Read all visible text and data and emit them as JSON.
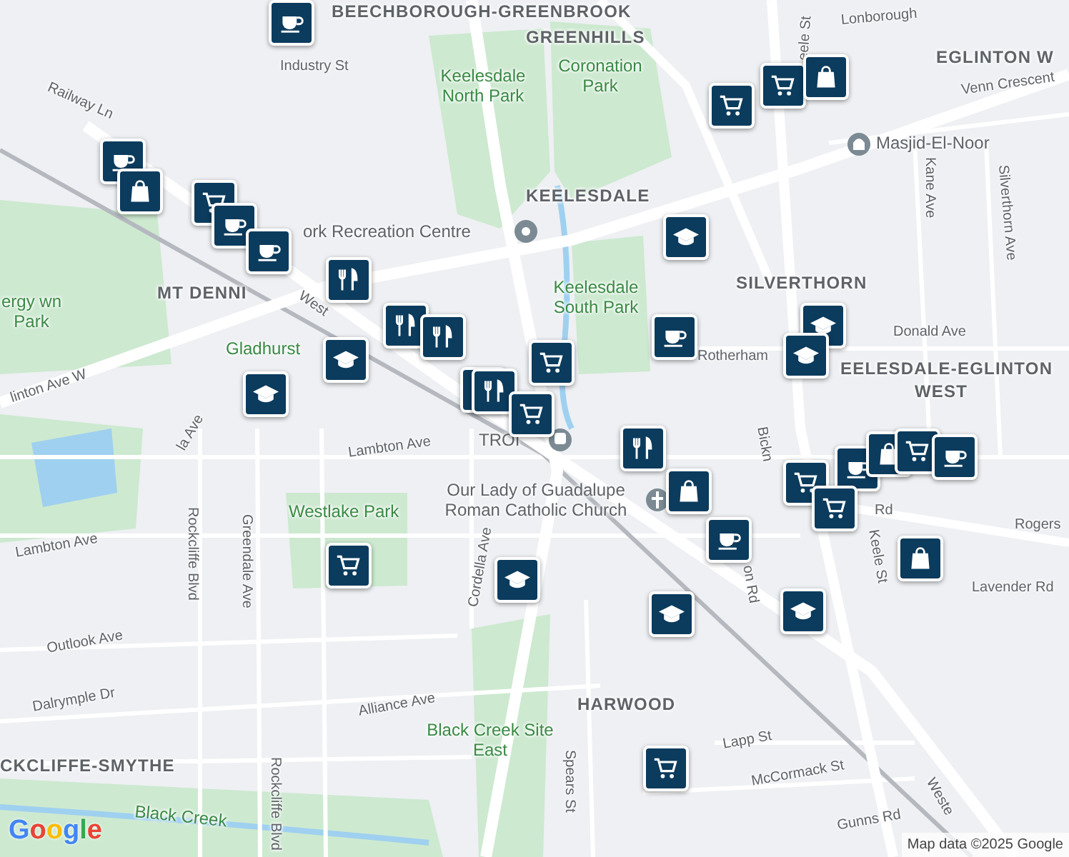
{
  "map": {
    "labels": [
      {
        "text": "BEECHBOROUGH-GREENBROOK",
        "kind": "district"
      },
      {
        "text": "GREENHILLS",
        "kind": "district"
      },
      {
        "text": "EGLINTON W",
        "kind": "district"
      },
      {
        "text": "KEELESDALE",
        "kind": "district"
      },
      {
        "text": "SILVERTHORN",
        "kind": "district"
      },
      {
        "text": "MT DENNI",
        "kind": "district"
      },
      {
        "text": "EELESDALE-EGLINTON",
        "kind": "district"
      },
      {
        "text": "WEST",
        "kind": "district"
      },
      {
        "text": "HARWOOD",
        "kind": "district"
      },
      {
        "text": "CKCLIFFE-SMYTHE",
        "kind": "district"
      },
      {
        "text": "Keelesdale North Park",
        "kind": "park"
      },
      {
        "text": "Coronation Park",
        "kind": "park"
      },
      {
        "text": "Keelesdale South Park",
        "kind": "park"
      },
      {
        "text": "Westlake Park",
        "kind": "park"
      },
      {
        "text": "Black Creek Site East",
        "kind": "park"
      },
      {
        "text": "ergy wn Park",
        "kind": "park"
      },
      {
        "text": "Gladhurst",
        "kind": "park"
      },
      {
        "text": "Black Creek",
        "kind": "park"
      },
      {
        "text": "ork Recreation Centre",
        "kind": "place"
      },
      {
        "text": "Masjid-El-Noor",
        "kind": "place"
      },
      {
        "text": "Our Lady of Guadalupe Roman Catholic Church",
        "kind": "place"
      },
      {
        "text": "TROI",
        "kind": "place"
      },
      {
        "text": "Industry St",
        "kind": "street"
      },
      {
        "text": "Railway Ln",
        "kind": "street"
      },
      {
        "text": "Venn Crescent",
        "kind": "street"
      },
      {
        "text": "Kane Ave",
        "kind": "street"
      },
      {
        "text": "Silverthorn Ave",
        "kind": "street"
      },
      {
        "text": "eele St",
        "kind": "street"
      },
      {
        "text": "Lonborough",
        "kind": "street"
      },
      {
        "text": "Rotherham",
        "kind": "street"
      },
      {
        "text": "Donald Ave",
        "kind": "street"
      },
      {
        "text": "Lambton Ave",
        "kind": "street"
      },
      {
        "text": "Lambton Ave",
        "kind": "street"
      },
      {
        "text": "la Ave",
        "kind": "street"
      },
      {
        "text": "Rockcliffe Blvd",
        "kind": "street"
      },
      {
        "text": "Greendale Ave",
        "kind": "street"
      },
      {
        "text": "Cordella Ave",
        "kind": "street"
      },
      {
        "text": "Outlook Ave",
        "kind": "street"
      },
      {
        "text": "Dalrymple Dr",
        "kind": "street"
      },
      {
        "text": "Alliance Ave",
        "kind": "street"
      },
      {
        "text": "Rockcliffe Blvd",
        "kind": "street"
      },
      {
        "text": "Spears St",
        "kind": "street"
      },
      {
        "text": "Lapp St",
        "kind": "street"
      },
      {
        "text": "McCormack St",
        "kind": "street"
      },
      {
        "text": "Gunns Rd",
        "kind": "street"
      },
      {
        "text": "Rogers",
        "kind": "street"
      },
      {
        "text": "Lavender Rd",
        "kind": "street"
      },
      {
        "text": "Keele St",
        "kind": "street"
      },
      {
        "text": "on Rd",
        "kind": "street"
      },
      {
        "text": "linton Ave W",
        "kind": "street"
      },
      {
        "text": "West",
        "kind": "street"
      },
      {
        "text": "Bickn",
        "kind": "street"
      },
      {
        "text": "Rd",
        "kind": "street"
      },
      {
        "text": "Weste",
        "kind": "street"
      }
    ],
    "markers": [
      {
        "kind": "coffee"
      },
      {
        "kind": "cart"
      },
      {
        "kind": "cart"
      },
      {
        "kind": "bag"
      },
      {
        "kind": "coffee"
      },
      {
        "kind": "bag"
      },
      {
        "kind": "cart"
      },
      {
        "kind": "coffee"
      },
      {
        "kind": "coffee"
      },
      {
        "kind": "dining"
      },
      {
        "kind": "dining"
      },
      {
        "kind": "dining"
      },
      {
        "kind": "dining"
      },
      {
        "kind": "school"
      },
      {
        "kind": "school"
      },
      {
        "kind": "dining"
      },
      {
        "kind": "cart"
      },
      {
        "kind": "cart"
      },
      {
        "kind": "school"
      },
      {
        "kind": "coffee"
      },
      {
        "kind": "school"
      },
      {
        "kind": "school"
      },
      {
        "kind": "dining"
      },
      {
        "kind": "bag"
      },
      {
        "kind": "coffee"
      },
      {
        "kind": "cart"
      },
      {
        "kind": "coffee"
      },
      {
        "kind": "bag"
      },
      {
        "kind": "cart"
      },
      {
        "kind": "coffee"
      },
      {
        "kind": "cart"
      },
      {
        "kind": "bag"
      },
      {
        "kind": "school"
      },
      {
        "kind": "school"
      },
      {
        "kind": "school"
      },
      {
        "kind": "cart"
      },
      {
        "kind": "cart"
      }
    ]
  },
  "footer": {
    "logo": "Google",
    "attribution": "Map data ©2025 Google"
  }
}
